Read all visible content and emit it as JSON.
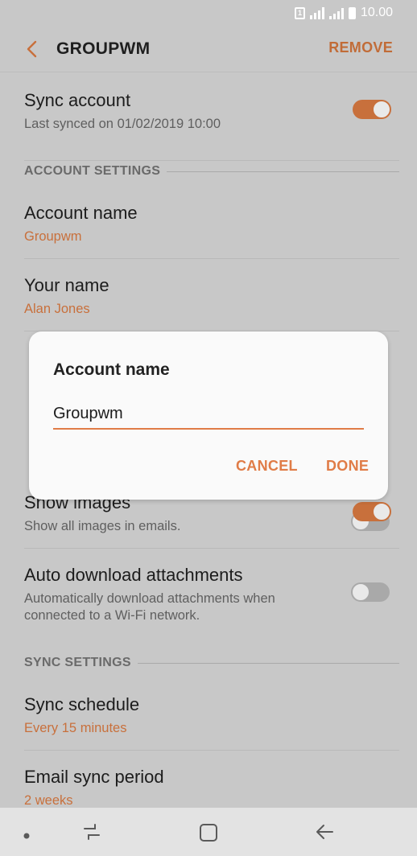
{
  "status_bar": {
    "time": "10.00",
    "sim_label": "1"
  },
  "app_bar": {
    "title": "GROUPWM",
    "remove_label": "REMOVE"
  },
  "sync_account": {
    "title": "Sync account",
    "subtitle": "Last synced on 01/02/2019  10:00",
    "enabled": true
  },
  "account_settings": {
    "header": "ACCOUNT SETTINGS",
    "account_name": {
      "title": "Account name",
      "value": "Groupwm"
    },
    "your_name": {
      "title": "Your name",
      "value": "Alan Jones"
    }
  },
  "show_images": {
    "title": "Show images",
    "subtitle": "Show all images in emails.",
    "enabled": true
  },
  "auto_download": {
    "title": "Auto download attachments",
    "subtitle": "Automatically download attachments when connected to a Wi-Fi network.",
    "enabled": false
  },
  "sync_settings": {
    "header": "SYNC SETTINGS",
    "sync_schedule": {
      "title": "Sync schedule",
      "value": "Every 15 minutes"
    },
    "email_sync_period": {
      "title": "Email sync period",
      "value": "2 weeks"
    }
  },
  "dialog": {
    "title": "Account name",
    "input_value": "Groupwm",
    "cancel_label": "CANCEL",
    "done_label": "DONE"
  },
  "colors": {
    "accent": "#c8703c",
    "dialog_accent": "#e07c47",
    "scrim_background": "#c8c8c8"
  }
}
